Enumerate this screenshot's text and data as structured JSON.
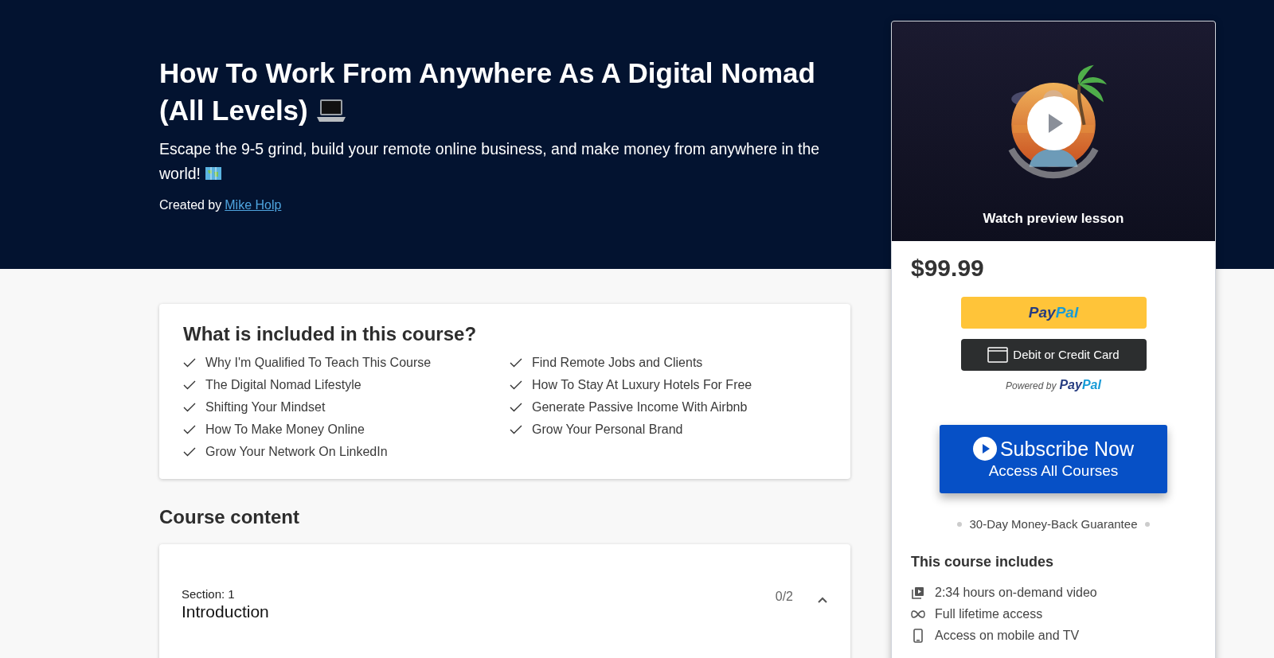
{
  "hero": {
    "title": "How To Work From Anywhere As A Digital Nomad (All Levels)",
    "subtitle": "Escape the 9-5 grind, build your remote online business, and make money from anywhere in the world!",
    "created_by_label": "Created by",
    "author": "Mike Holp"
  },
  "included": {
    "title": "What is included in this course?",
    "columns": [
      [
        "Why I'm Qualified To Teach This Course",
        "The Digital Nomad Lifestyle",
        "Shifting Your Mindset",
        "How To Make Money Online",
        "Grow Your Network On LinkedIn"
      ],
      [
        "Find Remote Jobs and Clients",
        "How To Stay At Luxury Hotels For Free",
        "Generate Passive Income With Airbnb",
        "Grow Your Personal Brand"
      ]
    ]
  },
  "course_content": {
    "title": "Course content",
    "sections": [
      {
        "label": "Section: 1",
        "title": "Introduction",
        "progress": "0/2",
        "expanded": true
      }
    ]
  },
  "sidebar": {
    "preview": {
      "kind": "picture",
      "caption": "Watch preview lesson"
    },
    "price": "$99.99",
    "paypal_button": {
      "logo_parts": [
        "Pay",
        "Pal"
      ]
    },
    "card_button": {
      "label": "Debit or Credit Card"
    },
    "powered_by": {
      "label": "Powered by",
      "logo_parts": [
        "Pay",
        "Pal"
      ]
    },
    "subscribe_button": {
      "title": "Subscribe Now",
      "subtitle": "Access All Courses"
    },
    "guarantee": "30-Day Money-Back Guarantee",
    "includes": {
      "title": "This course includes",
      "items": [
        {
          "kind": "video",
          "text": "2:34 hours on-demand video"
        },
        {
          "kind": "infinity",
          "text": "Full lifetime access"
        },
        {
          "kind": "mobile",
          "text": "Access on mobile and TV"
        }
      ]
    }
  }
}
